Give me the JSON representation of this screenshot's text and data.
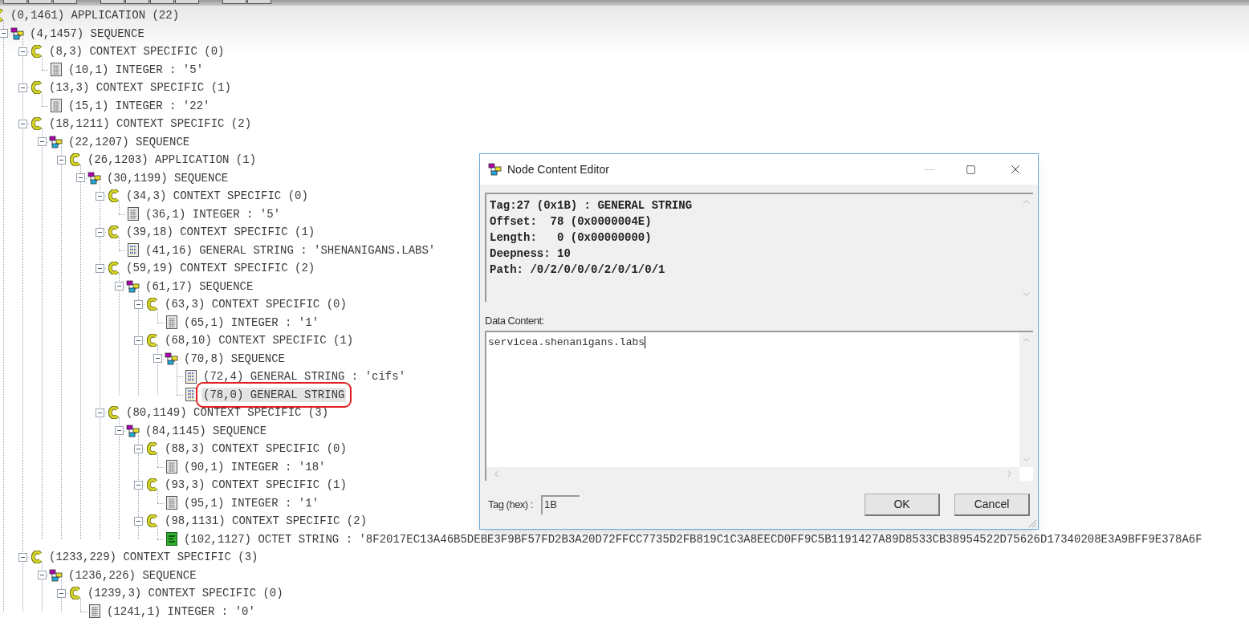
{
  "tree": [
    {
      "kind": "context",
      "text": "(0,1461) APPLICATION (22)",
      "selected": false,
      "children": [
        {
          "kind": "sequence",
          "text": "(4,1457) SEQUENCE",
          "expanded": true,
          "selected": false,
          "children": [
            {
              "kind": "context",
              "text": "(8,3) CONTEXT SPECIFIC (0)",
              "expanded": true,
              "selected": false,
              "children": [
                {
                  "kind": "integer",
                  "text": "(10,1) INTEGER : '5'",
                  "selected": false
                }
              ]
            },
            {
              "kind": "context",
              "text": "(13,3) CONTEXT SPECIFIC (1)",
              "expanded": true,
              "selected": false,
              "children": [
                {
                  "kind": "integer",
                  "text": "(15,1) INTEGER : '22'",
                  "selected": false
                }
              ]
            },
            {
              "kind": "context",
              "text": "(18,1211) CONTEXT SPECIFIC (2)",
              "expanded": true,
              "selected": false,
              "children": [
                {
                  "kind": "sequence",
                  "text": "(22,1207) SEQUENCE",
                  "expanded": true,
                  "selected": false,
                  "children": [
                    {
                      "kind": "context",
                      "text": "(26,1203) APPLICATION (1)",
                      "expanded": true,
                      "selected": false,
                      "children": [
                        {
                          "kind": "sequence",
                          "text": "(30,1199) SEQUENCE",
                          "expanded": true,
                          "selected": false,
                          "children": [
                            {
                              "kind": "context",
                              "text": "(34,3) CONTEXT SPECIFIC (0)",
                              "expanded": true,
                              "selected": false,
                              "children": [
                                {
                                  "kind": "integer",
                                  "text": "(36,1) INTEGER : '5'",
                                  "selected": false
                                }
                              ]
                            },
                            {
                              "kind": "context",
                              "text": "(39,18) CONTEXT SPECIFIC (1)",
                              "expanded": true,
                              "selected": false,
                              "children": [
                                {
                                  "kind": "string",
                                  "text": "(41,16) GENERAL STRING : 'SHENANIGANS.LABS'",
                                  "selected": false
                                }
                              ]
                            },
                            {
                              "kind": "context",
                              "text": "(59,19) CONTEXT SPECIFIC (2)",
                              "expanded": true,
                              "selected": false,
                              "children": [
                                {
                                  "kind": "sequence",
                                  "text": "(61,17) SEQUENCE",
                                  "expanded": true,
                                  "selected": false,
                                  "children": [
                                    {
                                      "kind": "context",
                                      "text": "(63,3) CONTEXT SPECIFIC (0)",
                                      "expanded": true,
                                      "selected": false,
                                      "children": [
                                        {
                                          "kind": "integer",
                                          "text": "(65,1) INTEGER : '1'",
                                          "selected": false
                                        }
                                      ]
                                    },
                                    {
                                      "kind": "context",
                                      "text": "(68,10) CONTEXT SPECIFIC (1)",
                                      "expanded": true,
                                      "selected": false,
                                      "children": [
                                        {
                                          "kind": "sequence",
                                          "text": "(70,8) SEQUENCE",
                                          "expanded": true,
                                          "selected": false,
                                          "children": [
                                            {
                                              "kind": "string",
                                              "text": "(72,4) GENERAL STRING : 'cifs'",
                                              "selected": false
                                            },
                                            {
                                              "kind": "string",
                                              "text": "(78,0) GENERAL STRING",
                                              "selected": true
                                            }
                                          ]
                                        }
                                      ]
                                    }
                                  ]
                                }
                              ]
                            },
                            {
                              "kind": "context",
                              "text": "(80,1149) CONTEXT SPECIFIC (3)",
                              "expanded": true,
                              "selected": false,
                              "children": [
                                {
                                  "kind": "sequence",
                                  "text": "(84,1145) SEQUENCE",
                                  "expanded": true,
                                  "selected": false,
                                  "children": [
                                    {
                                      "kind": "context",
                                      "text": "(88,3) CONTEXT SPECIFIC (0)",
                                      "expanded": true,
                                      "selected": false,
                                      "children": [
                                        {
                                          "kind": "integer",
                                          "text": "(90,1) INTEGER : '18'",
                                          "selected": false
                                        }
                                      ]
                                    },
                                    {
                                      "kind": "context",
                                      "text": "(93,3) CONTEXT SPECIFIC (1)",
                                      "expanded": true,
                                      "selected": false,
                                      "children": [
                                        {
                                          "kind": "integer",
                                          "text": "(95,1) INTEGER : '1'",
                                          "selected": false
                                        }
                                      ]
                                    },
                                    {
                                      "kind": "context",
                                      "text": "(98,1131) CONTEXT SPECIFIC (2)",
                                      "expanded": true,
                                      "selected": false,
                                      "children": [
                                        {
                                          "kind": "octet",
                                          "text": "(102,1127) OCTET STRING : '8F2017EC13A46B5DEBE3F9BF57FD2B3A20D72FFCC7735D2FB819C1C3A8EECD0FF9C5B1191427A89D8533CB38954522D75626D17340208E3A9BFF9E378A6F",
                                          "selected": false
                                        }
                                      ]
                                    }
                                  ]
                                }
                              ]
                            }
                          ]
                        }
                      ]
                    }
                  ]
                }
              ]
            },
            {
              "kind": "context",
              "text": "(1233,229) CONTEXT SPECIFIC (3)",
              "expanded": true,
              "selected": false,
              "children": [
                {
                  "kind": "sequence",
                  "text": "(1236,226) SEQUENCE",
                  "expanded": true,
                  "selected": false,
                  "children": [
                    {
                      "kind": "context",
                      "text": "(1239,3) CONTEXT SPECIFIC (0)",
                      "expanded": true,
                      "selected": false,
                      "children": [
                        {
                          "kind": "integer",
                          "text": "(1241,1) INTEGER : '0'",
                          "selected": false
                        }
                      ]
                    }
                  ]
                }
              ]
            }
          ]
        }
      ]
    }
  ],
  "dialog": {
    "title": "Node Content Editor",
    "minimize_enabled": false,
    "info_lines": [
      "Tag:27 (0x1B) : GENERAL STRING",
      "Offset:  78 (0x0000004E)",
      "Length:   0 (0x00000000)",
      "Deepness: 10",
      "Path: /0/2/0/0/0/2/0/1/0/1"
    ],
    "data_label": "Data Content:",
    "data_value": "servicea.shenanigans.labs",
    "tag_label": "Tag (hex) :",
    "tag_value": "1B",
    "buttons": [
      "OK",
      "Cancel"
    ]
  }
}
